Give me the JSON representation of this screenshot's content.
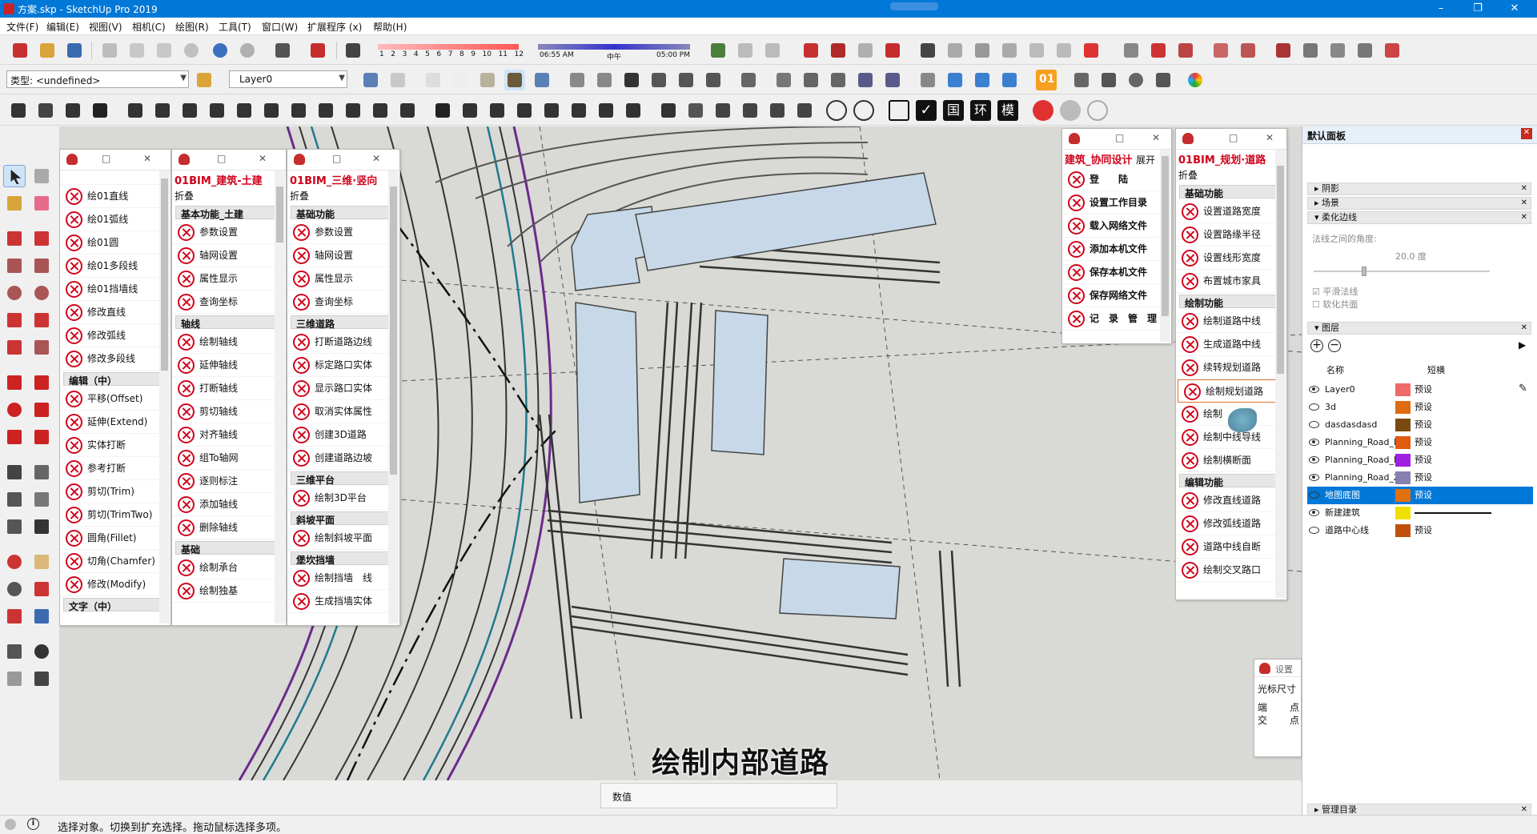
{
  "window": {
    "title": "方案.skp - SketchUp Pro 2019",
    "min": "–",
    "max": "❐",
    "close": "✕"
  },
  "menu": [
    "文件(F)",
    "编辑(E)",
    "视图(V)",
    "相机(C)",
    "绘图(R)",
    "工具(T)",
    "窗口(W)",
    "扩展程序 (x)",
    "帮助(H)"
  ],
  "toolbar": {
    "shadow_ticks": [
      "1",
      "2",
      "3",
      "4",
      "5",
      "6",
      "7",
      "8",
      "9",
      "10",
      "11",
      "12"
    ],
    "time_start": "06:55 AM",
    "time_mid": "中午",
    "time_end": "05:00 PM",
    "type_label": "类型:",
    "type_value": "<undefined>",
    "layer_value": "Layer0",
    "badge01": "01",
    "text_btns": [
      "国",
      "环",
      "模"
    ]
  },
  "panel_edit": {
    "items_top": [
      "绘01直线",
      "绘01弧线",
      "绘01圆",
      "绘01多段线",
      "绘01挡墙线",
      "修改直线",
      "修改弧线",
      "修改多段线"
    ],
    "section": "编辑（中）",
    "items": [
      "平移(Offset)",
      "延伸(Extend)",
      "实体打断",
      "参考打断",
      "剪切(Trim)",
      "剪切(TrimTwo)",
      "圆角(Fillet)",
      "切角(Chamfer)",
      "修改(Modify)"
    ],
    "section2": "文字（中）"
  },
  "panel_arch": {
    "title": "01BIM_建筑-土建",
    "fold": "折叠",
    "sections": [
      {
        "name": "基本功能_土建",
        "items": [
          "参数设置",
          "轴网设置",
          "属性显示",
          "查询坐标"
        ]
      },
      {
        "name": "轴线",
        "items": [
          "绘制轴线",
          "延伸轴线",
          "打断轴线",
          "剪切轴线",
          "对齐轴线",
          "组To轴网",
          "逐则标注",
          "添加轴线",
          "删除轴线"
        ]
      },
      {
        "name": "基础",
        "items": [
          "绘制承台",
          "绘制独基"
        ]
      }
    ]
  },
  "panel_3d": {
    "title": "01BIM_三维·竖向",
    "fold": "折叠",
    "sections": [
      {
        "name": "基础功能",
        "items": [
          "参数设置",
          "轴网设置",
          "属性显示",
          "查询坐标"
        ]
      },
      {
        "name": "三维道路",
        "items": [
          "打断道路边线",
          "标定路口实体",
          "显示路口实体",
          "取消实体属性",
          "创建3D道路",
          "创建道路边坡"
        ]
      },
      {
        "name": "三维平台",
        "items": [
          "绘制3D平台"
        ]
      },
      {
        "name": "斜坡平面",
        "items": [
          "绘制斜坡平面"
        ]
      },
      {
        "name": "堡坎挡墙",
        "items": [
          "绘制挡墙　线",
          "生成挡墙实体"
        ]
      }
    ]
  },
  "panel_collab": {
    "title": "建筑_协同设计",
    "expand": "展开",
    "items": [
      "登　　陆",
      "设置工作目录",
      "载入网络文件",
      "添加本机文件",
      "保存本机文件",
      "保存网络文件",
      "记　录　管　理"
    ]
  },
  "panel_road": {
    "title": "01BIM_规划·道路",
    "fold": "折叠",
    "sections": [
      {
        "name": "基础功能",
        "items": [
          "设置道路宽度",
          "设置路缘半径",
          "设置线形宽度",
          "布置城市家具"
        ]
      },
      {
        "name": "绘制功能",
        "items": [
          "绘制道路中线",
          "生成道路中线",
          "续转规划道路",
          "绘制规划道路",
          "绘制",
          "绘制中线导线",
          "绘制横断面"
        ]
      },
      {
        "name": "编辑功能",
        "items": [
          "修改直线道路",
          "修改弧线道路",
          "道路中线自断",
          "绘制交叉路口"
        ]
      }
    ]
  },
  "small_panel": {
    "title": "设置",
    "label": "光标尺寸",
    "row1a": "端",
    "row1b": "点",
    "row2a": "交",
    "row2b": "点"
  },
  "default_panel": {
    "title": "默认面板",
    "trays": [
      "阴影",
      "场景",
      "柔化边线"
    ],
    "angle_label": "法线之间的角度:",
    "angle_value": "20.0  度",
    "check_smooth": "平滑法线",
    "check_coplanar": "软化共面",
    "layers_tray": "图层",
    "col_name": "名称",
    "col_line": "短横",
    "layers": [
      {
        "name": "Layer0",
        "color": "#f06a6a",
        "line": "预设",
        "visible": true
      },
      {
        "name": "3d",
        "color": "#e06a10",
        "line": "预设",
        "visible": false
      },
      {
        "name": "dasdasdasd",
        "color": "#7a4a10",
        "line": "预设",
        "visible": false
      },
      {
        "name": "Planning_Road_HX",
        "color": "#e05a10",
        "line": "预设",
        "visible": true
      },
      {
        "name": "Planning_Road_LY",
        "color": "#a020e0",
        "line": "预设",
        "visible": true
      },
      {
        "name": "Planning_Road_ZX",
        "color": "#8a80b0",
        "line": "预设",
        "visible": true
      },
      {
        "name": "地图底图",
        "color": "#e07010",
        "line": "预设",
        "visible": false,
        "selected": true
      },
      {
        "name": "新建建筑",
        "color": "#f0e000",
        "line": "",
        "visible": true
      },
      {
        "name": "道路中心线",
        "color": "#c05010",
        "line": "预设",
        "visible": false
      }
    ],
    "manage_tray": "管理目录"
  },
  "subtitle": "绘制内部道路",
  "measure_label": "数值",
  "status_text": "选择对象。切换到扩充选择。拖动鼠标选择多项。",
  "colors": {
    "title_blue": "#0078d7",
    "accent_red": "#d0021b",
    "select_blue": "#0078d7"
  }
}
